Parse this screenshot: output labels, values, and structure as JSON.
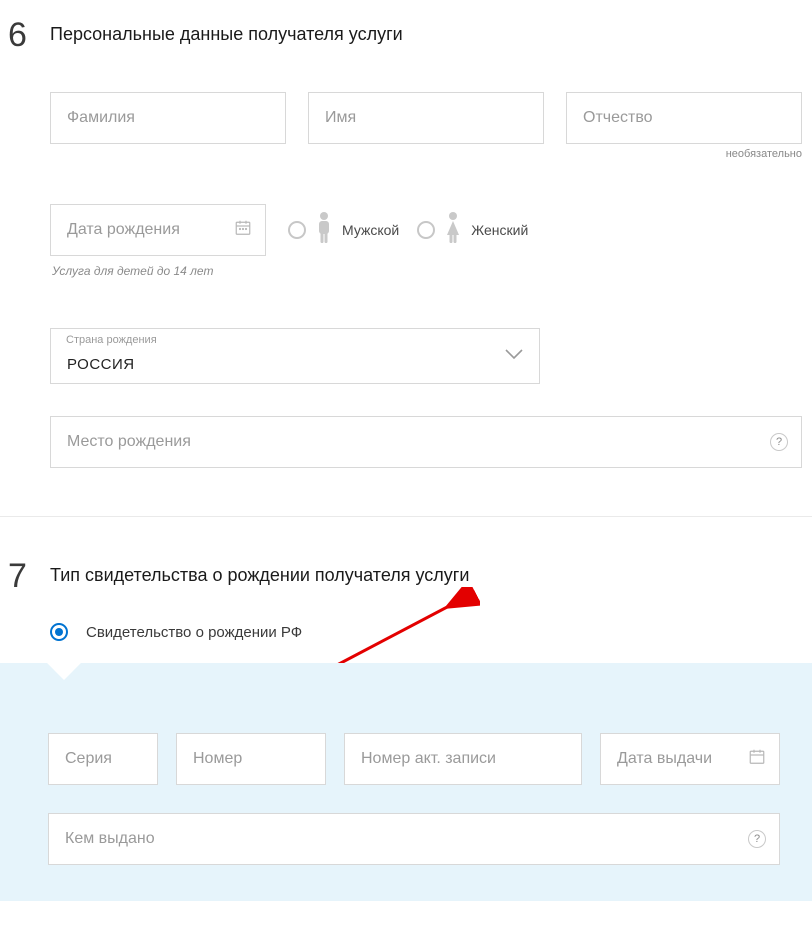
{
  "section6": {
    "number": "6",
    "title": "Персональные данные получателя услуги",
    "fields": {
      "lastname": "Фамилия",
      "firstname": "Имя",
      "middlename": "Отчество",
      "middlename_hint": "необязательно",
      "dob": "Дата рождения",
      "dob_hint": "Услуга для детей до 14 лет",
      "gender_male": "Мужской",
      "gender_female": "Женский",
      "country_label": "Страна рождения",
      "country_value": "РОССИЯ",
      "birthplace": "Место рождения"
    }
  },
  "section7": {
    "number": "7",
    "title": "Тип свидетельства о рождении получателя услуги",
    "radio_label": "Свидетельство о рождении РФ",
    "fields": {
      "series": "Серия",
      "number": "Номер",
      "act_number": "Номер акт. записи",
      "issue_date": "Дата выдачи",
      "issued_by": "Кем выдано"
    }
  },
  "icons": {
    "help": "?"
  }
}
